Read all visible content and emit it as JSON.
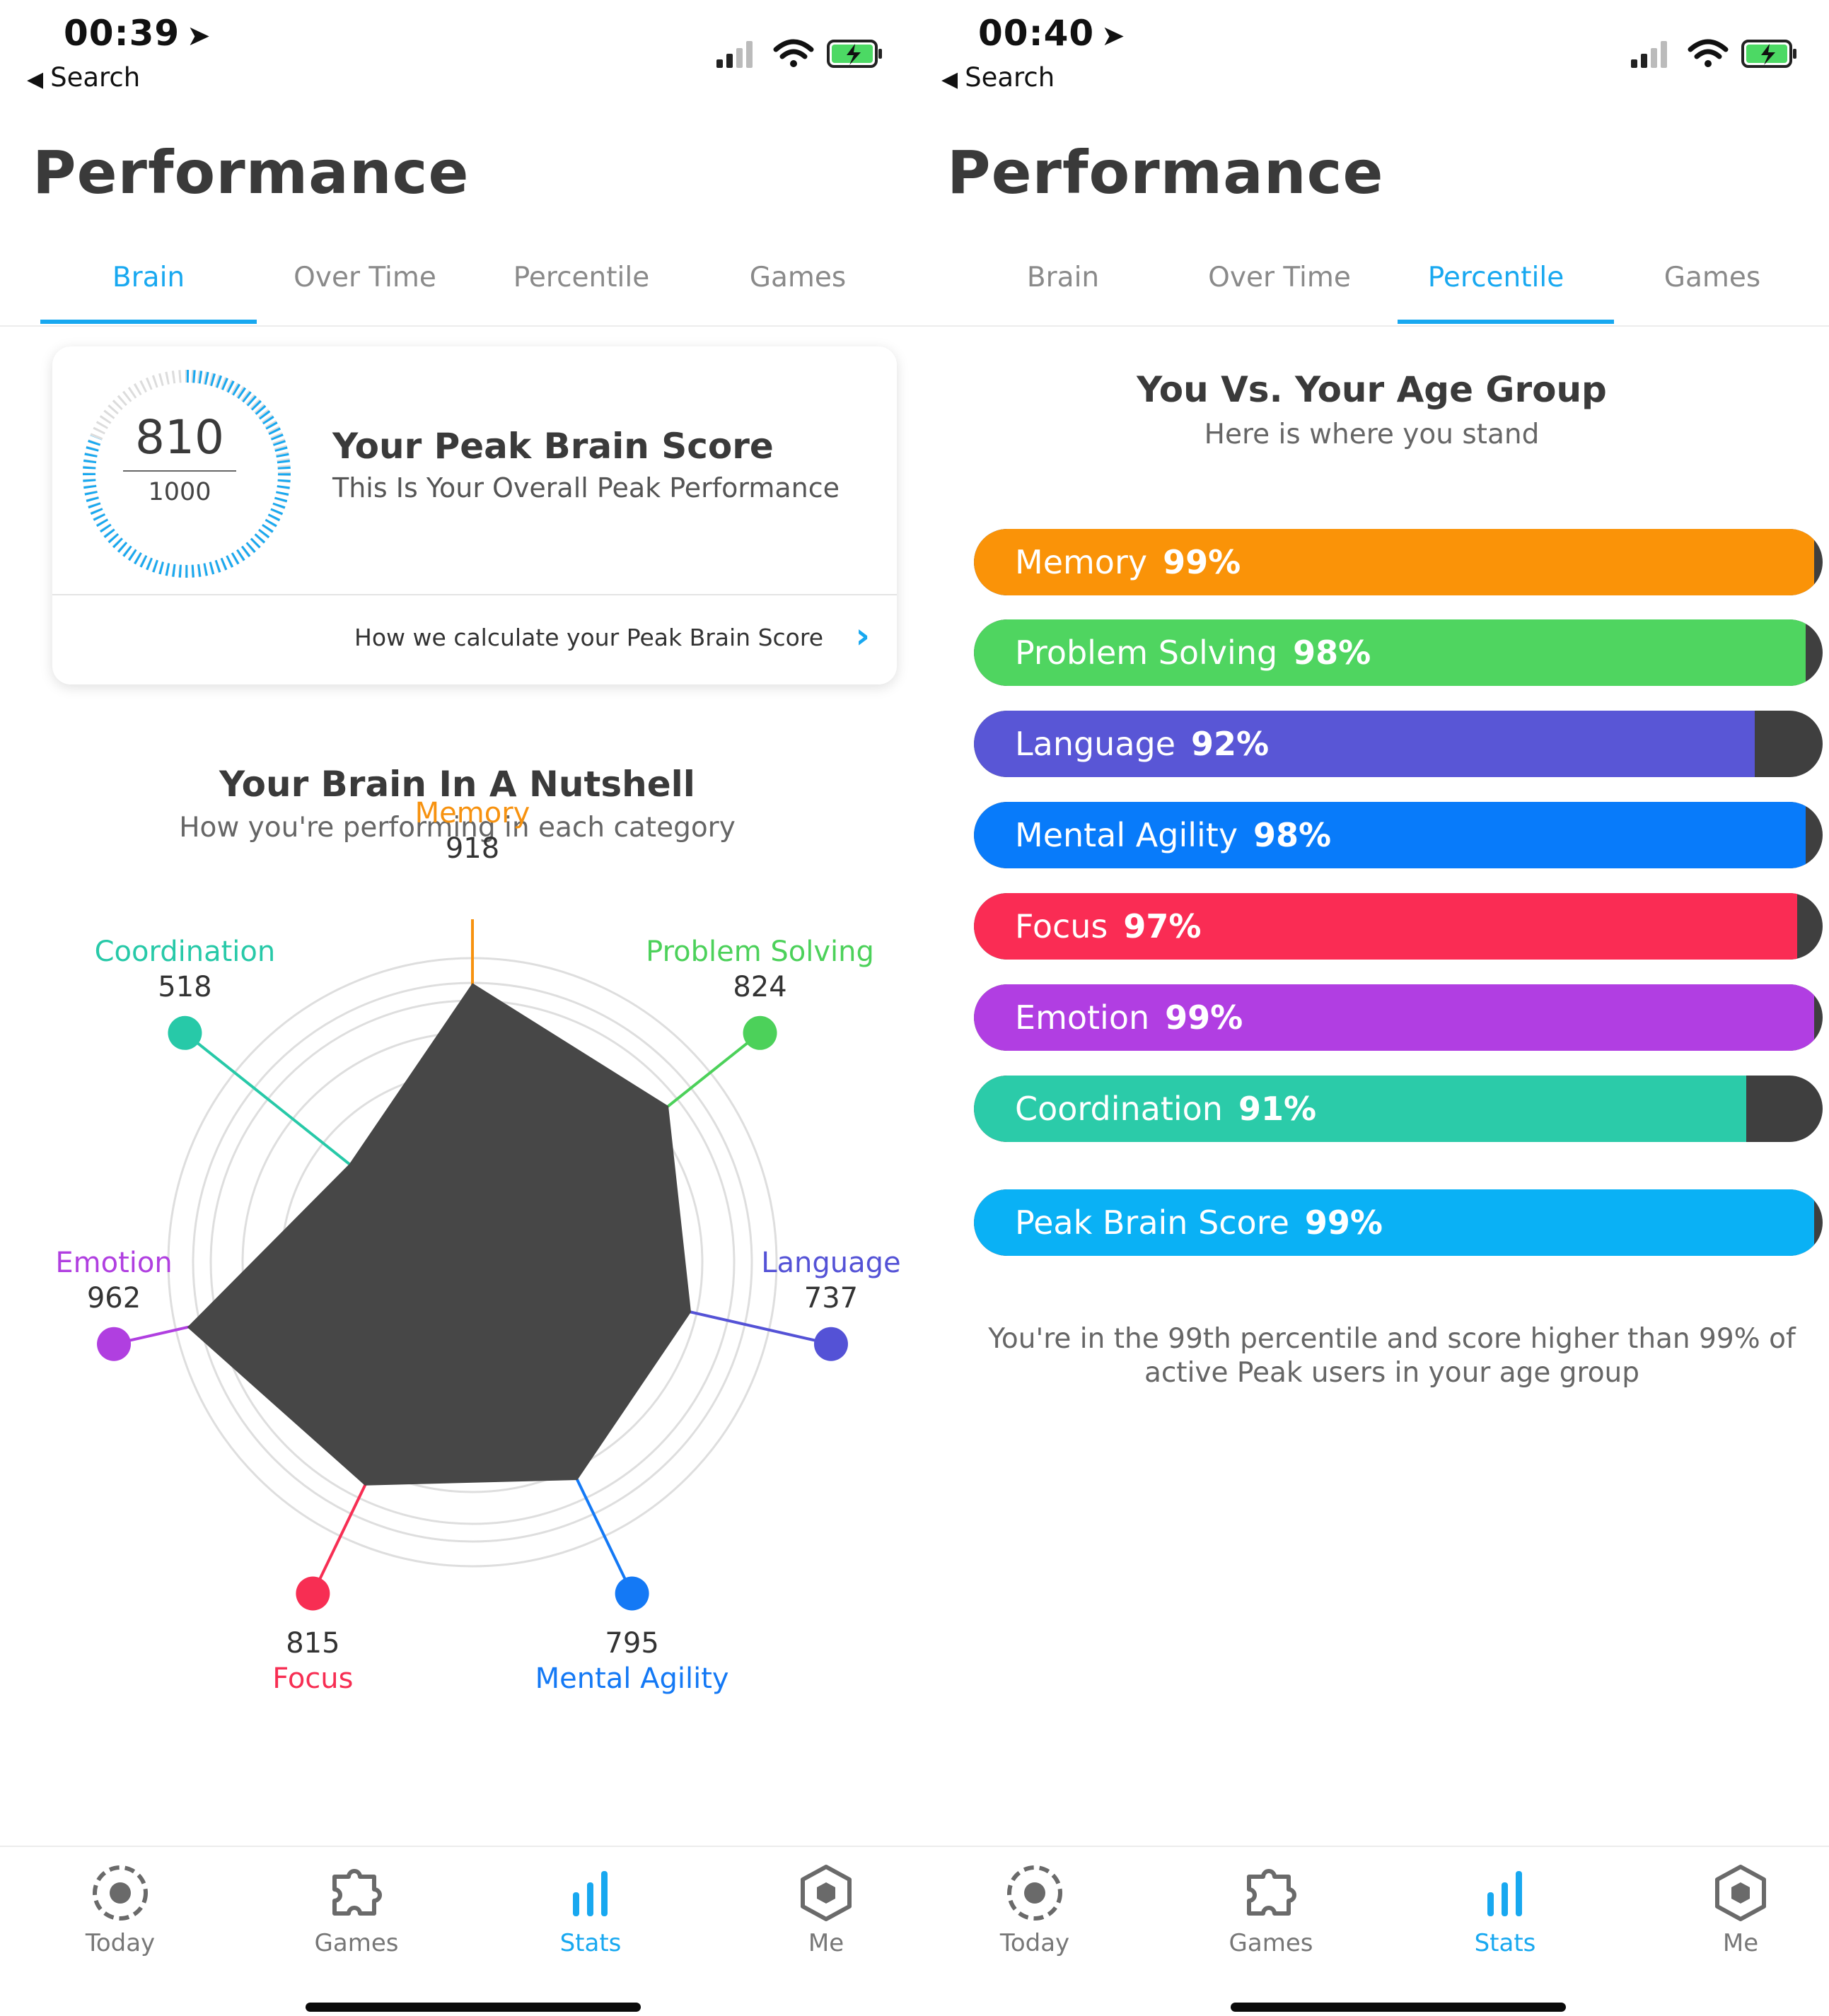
{
  "screens": [
    {
      "status": {
        "time": "00:39",
        "back_label": "Search"
      },
      "title": "Performance",
      "tabs": [
        "Brain",
        "Over Time",
        "Percentile",
        "Games"
      ],
      "active_tab": "Brain",
      "peak_card": {
        "score": "810",
        "max": "1000",
        "score_fraction": 0.81,
        "title": "Your Peak Brain Score",
        "subtitle": "This Is Your Overall Peak Performance",
        "link": "How we calculate your Peak Brain Score"
      },
      "nutshell": {
        "title": "Your Brain In A Nutshell",
        "subtitle": "How you're performing in each category",
        "categories": [
          {
            "name": "Memory",
            "score": "918",
            "value": 918,
            "color": "#f7920f"
          },
          {
            "name": "Problem Solving",
            "score": "824",
            "value": 824,
            "color": "#4cd15a"
          },
          {
            "name": "Language",
            "score": "737",
            "value": 737,
            "color": "#5452d6"
          },
          {
            "name": "Mental Agility",
            "score": "795",
            "value": 795,
            "color": "#1479f5"
          },
          {
            "name": "Focus",
            "score": "815",
            "value": 815,
            "color": "#f72e53"
          },
          {
            "name": "Emotion",
            "score": "962",
            "value": 962,
            "color": "#b03fe0"
          },
          {
            "name": "Coordination",
            "score": "518",
            "value": 518,
            "color": "#27c9a8"
          }
        ]
      }
    },
    {
      "status": {
        "time": "00:40",
        "back_label": "Search"
      },
      "title": "Performance",
      "tabs": [
        "Brain",
        "Over Time",
        "Percentile",
        "Games"
      ],
      "active_tab": "Percentile",
      "percentile": {
        "title": "You Vs. Your Age Group",
        "subtitle": "Here is where you stand",
        "bars": [
          {
            "name": "Memory",
            "pct": "99%",
            "value": 99,
            "color": "#fa9308"
          },
          {
            "name": "Problem Solving",
            "pct": "98%",
            "value": 98,
            "color": "#4fd560"
          },
          {
            "name": "Language",
            "pct": "92%",
            "value": 92,
            "color": "#5956d6"
          },
          {
            "name": "Mental Agility",
            "pct": "98%",
            "value": 98,
            "color": "#087bfa"
          },
          {
            "name": "Focus",
            "pct": "97%",
            "value": 97,
            "color": "#fa2c54"
          },
          {
            "name": "Emotion",
            "pct": "99%",
            "value": 99,
            "color": "#b13ee2"
          },
          {
            "name": "Coordination",
            "pct": "91%",
            "value": 91,
            "color": "#2bcba9"
          },
          {
            "name": "Peak Brain Score",
            "pct": "99%",
            "value": 99,
            "color": "#0ab1f5"
          }
        ],
        "summary": "You're in the 99th percentile and score higher than 99% of active Peak users in your age group"
      }
    }
  ],
  "nav": {
    "items": [
      {
        "label": "Today",
        "icon": "today-icon"
      },
      {
        "label": "Games",
        "icon": "puzzle-icon"
      },
      {
        "label": "Stats",
        "icon": "stats-icon"
      },
      {
        "label": "Me",
        "icon": "hexagon-icon"
      }
    ],
    "active": "Stats",
    "accent": "#18a8f0"
  }
}
